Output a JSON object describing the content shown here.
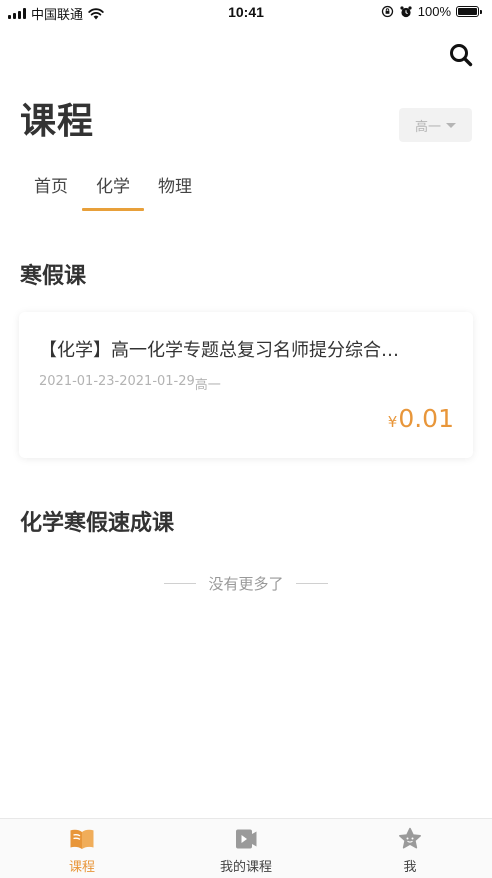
{
  "status_bar": {
    "carrier": "中国联通",
    "time": "10:41",
    "battery_percent": "100%"
  },
  "header": {
    "title": "课程",
    "grade_selected": "高一"
  },
  "tabs": [
    {
      "label": "首页",
      "active": false
    },
    {
      "label": "化学",
      "active": true
    },
    {
      "label": "物理",
      "active": false
    }
  ],
  "sections": [
    {
      "title": "寒假课",
      "courses": [
        {
          "title": "【化学】高一化学专题总复习名师提分综合…",
          "dates": "2021-01-23-2021-01-29",
          "grade": "高一",
          "currency": "¥",
          "price": "0.01"
        }
      ]
    },
    {
      "title": "化学寒假速成课",
      "courses": []
    }
  ],
  "no_more_text": "没有更多了",
  "bottom_nav": [
    {
      "label": "课程",
      "icon": "open-book-icon",
      "active": true
    },
    {
      "label": "我的课程",
      "icon": "play-document-icon",
      "active": false
    },
    {
      "label": "我",
      "icon": "star-face-icon",
      "active": false
    }
  ],
  "colors": {
    "accent": "#e8963a",
    "text_primary": "#333333",
    "text_muted": "#b3b3b3",
    "inactive_icon": "#9a9a9a"
  }
}
